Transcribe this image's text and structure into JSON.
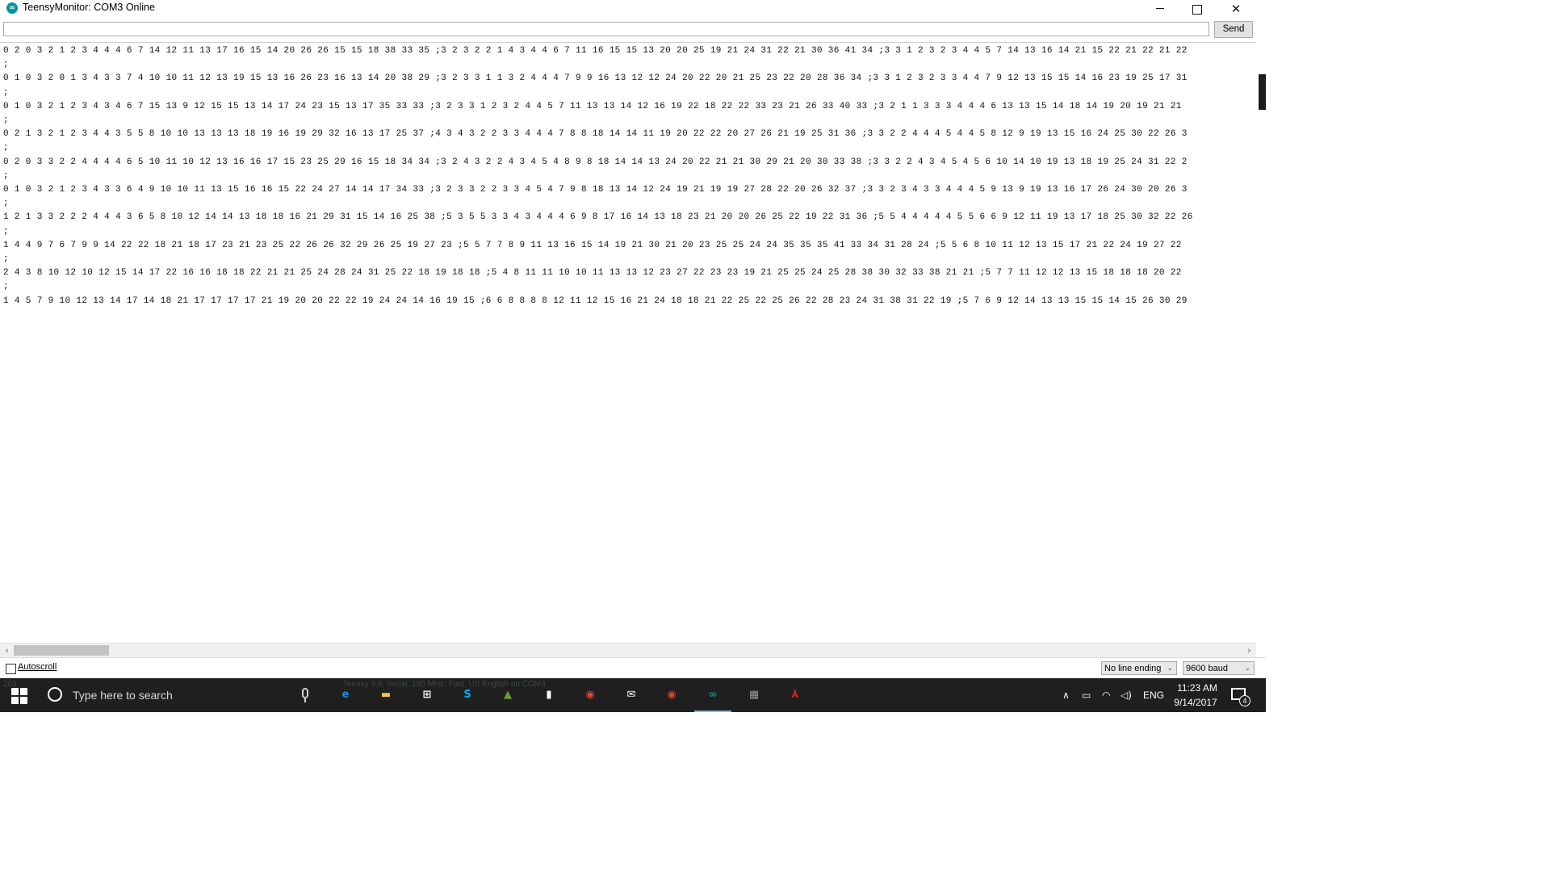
{
  "window": {
    "title": "TeensyMonitor: COM3 Online",
    "app_icon": "arduino-icon",
    "min_glyph": "—",
    "close_glyph": "✕"
  },
  "send_bar": {
    "input_value": "",
    "send_label": "Send"
  },
  "output_lines": [
    "0 2 0 3 2 1 2 3 4 4 4 6 7 14 12 11 13 17 16 15 14 20 26 26 15 15 18 38 33 35 ;3 2 3 2 2 1 4 3 4 4 6 7 11 16 15 15 13 20 20 25 19 21 24 31 22 21 30 36 41 34 ;3 3 1 2 3 2 3 4 4 5 7 14 13 16 14 21 15 22 21 22 21 22",
    ";",
    "0 1 0 3 2 0 1 3 4 3 3 7 4 10 10 11 12 13 19 15 13 16 26 23 16 13 14 20 38 29 ;3 2 3 3 1 1 3 2 4 4 4 7 9 9 16 13 12 12 24 20 22 20 21 25 23 22 20 28 36 34 ;3 3 1 2 3 2 3 3 4 4 7 9 12 13 15 15 14 16 23 19 25 17 31",
    ";",
    "0 1 0 3 2 1 2 3 4 3 4 6 7 15 13 9 12 15 15 13 14 17 24 23 15 13 17 35 33 33 ;3 2 3 3 1 2 3 2 4 4 5 7 11 13 13 14 12 16 19 22 18 22 22 33 23 21 26 33 40 33 ;3 2 1 1 3 3 3 4 4 4 6 13 13 15 14 18 14 19 20 19 21 21",
    ";",
    "0 2 1 3 2 1 2 3 4 4 3 5 5 8 10 10 13 13 13 18 19 16 19 29 32 16 13 17 25 37 ;4 3 4 3 2 2 3 3 4 4 4 7 8 8 18 14 14 11 19 20 22 22 20 27 26 21 19 25 31 36 ;3 3 2 2 4 4 4 5 4 4 5 8 12 9 19 13 15 16 24 25 30 22 26 3",
    ";",
    "0 2 0 3 3 2 2 4 4 4 4 6 5 10 11 10 12 13 16 16 17 15 23 25 29 16 15 18 34 34 ;3 2 4 3 2 2 4 3 4 5 4 8 9 8 18 14 14 13 24 20 22 21 21 30 29 21 20 30 33 38 ;3 3 2 2 4 3 4 5 4 5 6 10 14 10 19 13 18 19 25 24 31 22 2",
    ";",
    "0 1 0 3 2 1 2 3 4 3 3 6 4 9 10 10 11 13 15 16 16 15 22 24 27 14 14 17 34 33 ;3 2 3 3 2 2 3 3 4 5 4 7 9 8 18 13 14 12 24 19 21 19 19 27 28 22 20 26 32 37 ;3 3 2 3 4 3 3 4 4 4 5 9 13 9 19 13 16 17 26 24 30 20 26 3",
    ";",
    "1 2 1 3 3 2 2 2 4 4 4 3 6 5 8 10 12 14 14 13 18 18 16 21 29 31 15 14 16 25 38 ;5 3 5 5 3 3 4 3 4 4 4 6 9 8 17 16 14 13 18 23 21 20 20 26 25 22 19 22 31 36 ;5 5 4 4 4 4 4 5 5 6 6 9 12 11 19 13 17 18 25 30 32 22 26",
    ";",
    "1 4 4 9 7 6 7 9 9 14 22 22 18 21 18 17 23 21 23 25 22 26 26 32 29 26 25 19 27 23 ;5 5 7 7 8 9 11 13 16 15 14 19 21 30 21 20 23 25 25 24 24 35 35 35 41 33 34 31 28 24 ;5 5 6 8 10 11 12 13 15 17 21 22 24 19 27 22",
    ";",
    "2 4 3 8 10 12 10 12 15 14 17 22 16 16 18 18 22 21 21 25 24 28 24 31 25 22 18 19 18 18 ;5 4 8 11 11 10 10 11 13 13 12 23 27 22 23 23 19 21 25 25 24 25 28 38 30 32 33 38 21 21 ;5 7 7 11 12 12 13 15 18 18 18 20 22",
    ";",
    "1 4 5 7 9 10 12 13 14 17 14 18 21 17 17 17 17 21 19 20 20 22 22 19 24 24 14 16 19 15 ;6 6 8 8 8 8 12 11 12 15 16 21 24 18 18 21 22 25 22 25 26 22 28 23 24 31 38 31 22 19 ;5 7 6 9 12 14 13 13 15 15 14 15 26 30 29"
  ],
  "scrollbars": {
    "left_arrow": "‹",
    "right_arrow": "›"
  },
  "bottom": {
    "autoscroll_label": "Autoscroll",
    "autoscroll_checked": false,
    "line_ending": "No line ending",
    "baud": "9600 baud",
    "chevron": "⌄"
  },
  "taskbar": {
    "search_placeholder": "Type here to search",
    "ghost_text": "Teensy 3.6, Serial, 180 MHz, Fast, US English on COM3",
    "ghost_left": "203",
    "apps": [
      {
        "name": "edge-icon",
        "glyph": "e",
        "color": "#1e88e5"
      },
      {
        "name": "file-explorer-icon",
        "glyph": "▬",
        "color": "#f4c542"
      },
      {
        "name": "store-icon",
        "glyph": "⊞",
        "color": "#ffffff"
      },
      {
        "name": "skype-icon",
        "glyph": "S",
        "color": "#00aff0"
      },
      {
        "name": "photos-icon",
        "glyph": "▲",
        "color": "#6a9e3a"
      },
      {
        "name": "document-icon",
        "glyph": "▮",
        "color": "#ffffff"
      },
      {
        "name": "chrome-icon",
        "glyph": "◉",
        "color": "#db4437"
      },
      {
        "name": "mail-icon",
        "glyph": "✉",
        "color": "#ffffff"
      },
      {
        "name": "chrome-icon-2",
        "glyph": "◉",
        "color": "#db4437"
      },
      {
        "name": "arduino-taskbar-icon",
        "glyph": "∞",
        "color": "#00979c"
      },
      {
        "name": "board-icon",
        "glyph": "▦",
        "color": "#8aa38a"
      },
      {
        "name": "acrobat-icon",
        "glyph": "⅄",
        "color": "#e02020"
      }
    ],
    "language": "ENG",
    "time": "11:23 AM",
    "date": "9/14/2017",
    "notification_count": "4",
    "tray_icons": [
      {
        "name": "chevron-up-icon",
        "glyph": "∧"
      },
      {
        "name": "battery-icon",
        "glyph": "▭"
      },
      {
        "name": "wifi-icon",
        "glyph": "◠"
      },
      {
        "name": "volume-icon",
        "glyph": "◁)"
      }
    ]
  }
}
